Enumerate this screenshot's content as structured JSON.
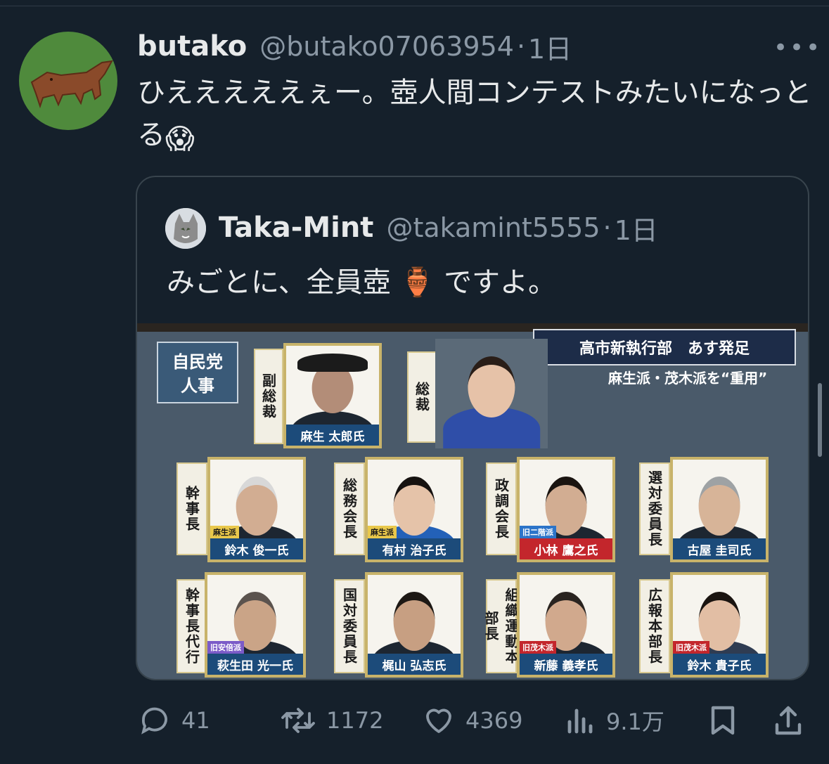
{
  "tweet": {
    "author_name": "butako",
    "author_handle": "@butako07063954",
    "separator": "·",
    "time": "1日",
    "more_icon": "more-icon",
    "text": "ひえええええぇー。壺人間コンテストみたいになっとる",
    "emoji": "😱"
  },
  "quote": {
    "author_name": "Taka-Mint",
    "author_handle": "@takamint5555",
    "separator": "·",
    "time": "1日",
    "text_before": "みごとに、全員壺",
    "emoji": "🏺",
    "text_after": "ですよ。",
    "image": {
      "corner_tag": "自民党\n人事",
      "headline": "高市新執行部　あす発足",
      "subline": "麻生派・茂木派を“重用”",
      "positions": [
        {
          "title": "副総裁",
          "name": "麻生 太郎氏",
          "faction": ""
        },
        {
          "title": "総裁",
          "name": "",
          "faction": ""
        },
        {
          "title": "幹事長",
          "name": "鈴木 俊一氏",
          "faction": "麻生派"
        },
        {
          "title": "総務会長",
          "name": "有村 治子氏",
          "faction": "麻生派"
        },
        {
          "title": "政調会長",
          "name": "小林 鷹之氏",
          "faction": "旧二階派"
        },
        {
          "title": "選対委員長",
          "name": "古屋 圭司氏",
          "faction": ""
        },
        {
          "title": "幹事長代行",
          "name": "萩生田 光一氏",
          "faction": "旧安倍派"
        },
        {
          "title": "国対委員長",
          "name": "梶山 弘志氏",
          "faction": ""
        },
        {
          "title": "組織運動本部長",
          "name": "新藤 義孝氏",
          "faction": "旧茂木派"
        },
        {
          "title": "広報本部長",
          "name": "鈴木 貴子氏",
          "faction": "旧茂木派"
        }
      ]
    }
  },
  "actions": {
    "reply_count": "41",
    "retweet_count": "1172",
    "like_count": "4369",
    "views_count": "9.1万"
  }
}
